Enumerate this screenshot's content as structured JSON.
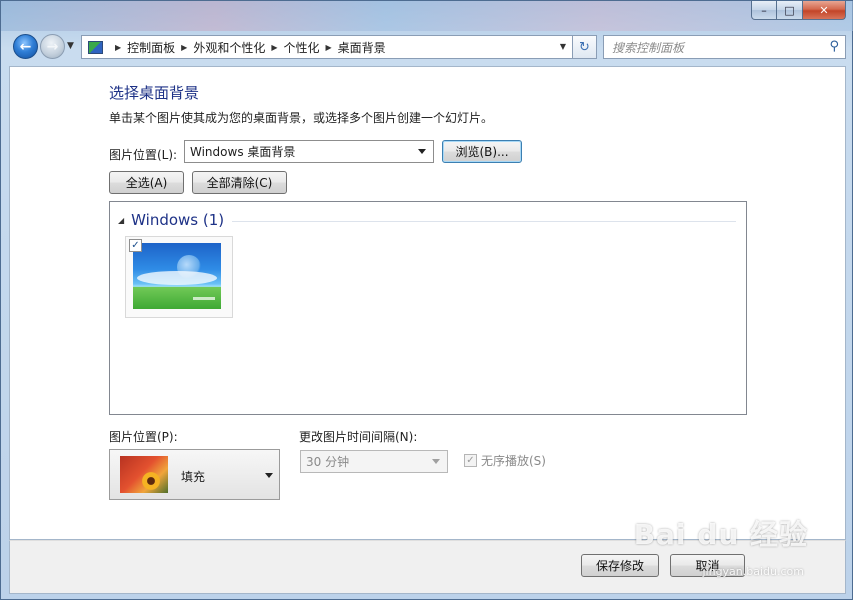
{
  "window": {
    "caption_buttons": {
      "minimize": "–",
      "maximize": "□",
      "close": "✕"
    }
  },
  "nav": {
    "back_icon": "back-arrow-icon",
    "forward_icon": "forward-arrow-icon",
    "breadcrumbs": [
      "控制面板",
      "外观和个性化",
      "个性化",
      "桌面背景"
    ],
    "search_placeholder": "搜索控制面板"
  },
  "page": {
    "title": "选择桌面背景",
    "description": "单击某个图片使其成为您的桌面背景，或选择多个图片创建一个幻灯片。",
    "picture_location_label": "图片位置(L):",
    "picture_location_value": "Windows 桌面背景",
    "browse_button": "浏览(B)...",
    "select_all_button": "全选(A)",
    "clear_all_button": "全部清除(C)",
    "gallery": {
      "group_title": "Windows (1)",
      "items": [
        {
          "checked": true
        }
      ]
    },
    "picture_position_label": "图片位置(P):",
    "picture_position_value": "填充",
    "interval_label": "更改图片时间间隔(N):",
    "interval_value": "30 分钟",
    "shuffle_label": "无序播放(S)",
    "shuffle_checked": true
  },
  "footer": {
    "save_button": "保存修改",
    "cancel_button": "取消"
  },
  "watermark": {
    "logo_text": "Bai du 经验",
    "sub_text": "jingyan.baidu.com"
  },
  "colors": {
    "title_blue": "#1e3287",
    "glass": "#bcd2ea",
    "close_red": "#c34428"
  }
}
